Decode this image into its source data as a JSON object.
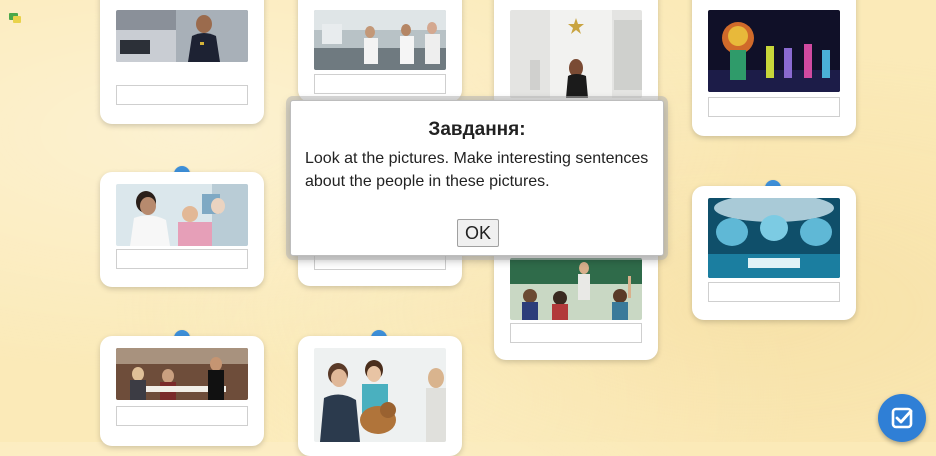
{
  "modal": {
    "title": "Завдання:",
    "text": "Look at the pictures. Make interesting sentences about the people in these pictures.",
    "ok_label": "OK"
  },
  "cards": [
    {
      "id": "police",
      "photo": "police-officer-photo",
      "answer": ""
    },
    {
      "id": "lab",
      "photo": "lab-scientists-photo",
      "answer": ""
    },
    {
      "id": "actress",
      "photo": "trailer-woman-photo",
      "answer": ""
    },
    {
      "id": "stage",
      "photo": "stage-performers-photo",
      "answer": ""
    },
    {
      "id": "dentist",
      "photo": "dentist-photo",
      "answer": ""
    },
    {
      "id": "surgeons",
      "photo": "surgeons-photo",
      "answer": ""
    },
    {
      "id": "teacher",
      "photo": "teacher-classroom-photo",
      "answer": ""
    },
    {
      "id": "waiter",
      "photo": "waiter-restaurant-photo",
      "answer": ""
    },
    {
      "id": "vet",
      "photo": "vet-dog-photo",
      "answer": ""
    }
  ],
  "colors": {
    "background": "#fbeab8",
    "pin": "#3d8fd9",
    "check_button": "#2f7fd6"
  },
  "icons": {
    "corner": "hint-icon",
    "check": "check-icon"
  }
}
